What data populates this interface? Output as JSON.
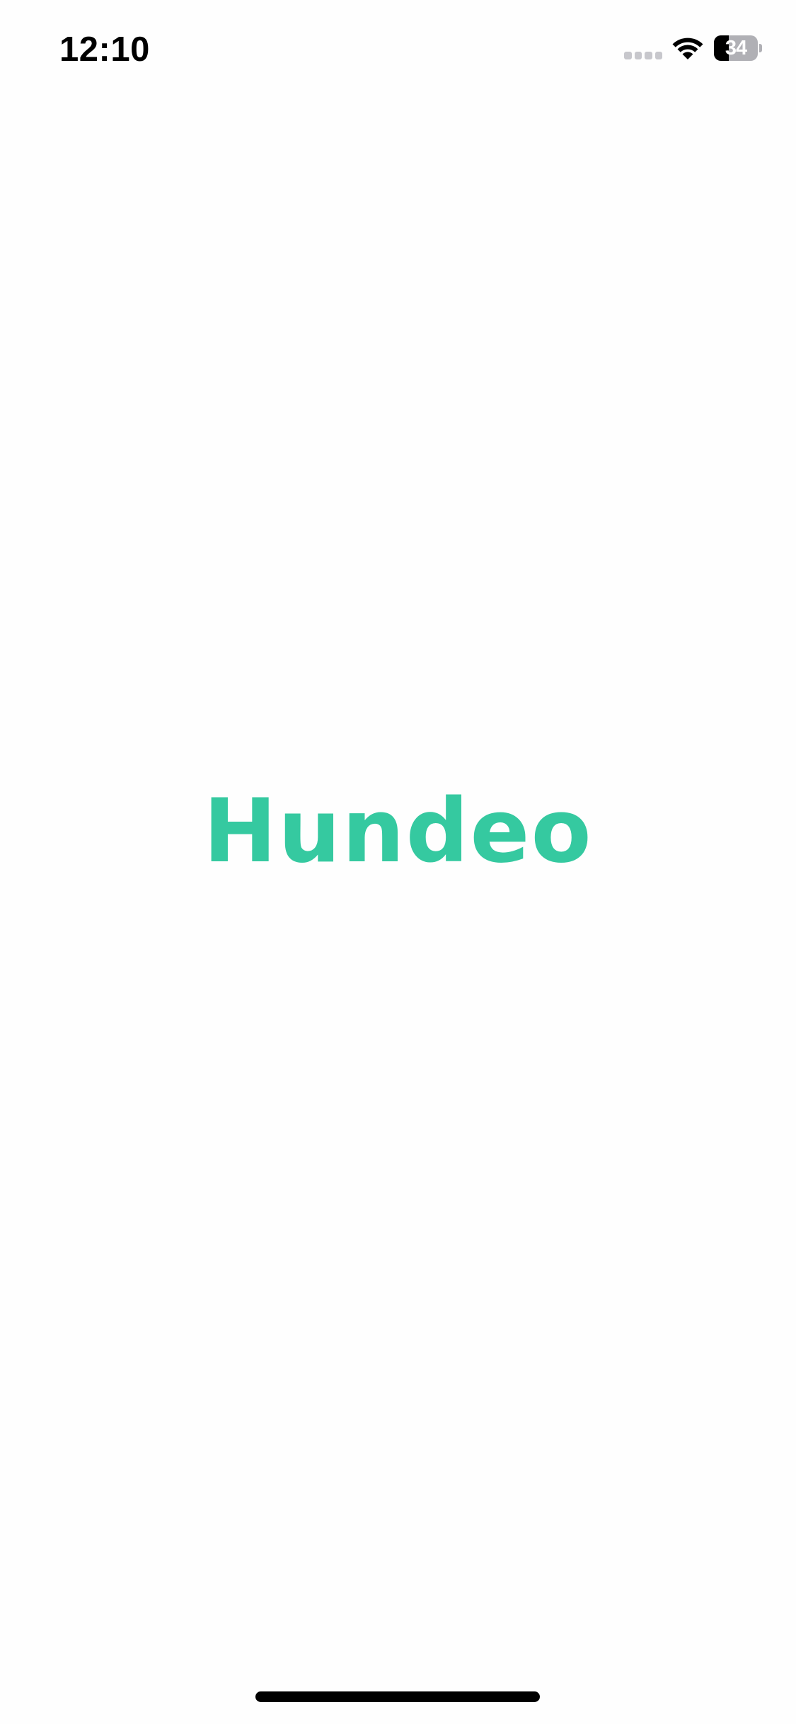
{
  "status_bar": {
    "time": "12:10",
    "battery_level": "34",
    "battery_fraction": 0.34,
    "signal_icon": "cellular-signal-icon",
    "wifi_icon": "wifi-icon"
  },
  "logo": {
    "text": "Hundeo",
    "color": "#35c9a0"
  },
  "colors": {
    "background": "#fefefe",
    "accent": "#35c9a0"
  }
}
